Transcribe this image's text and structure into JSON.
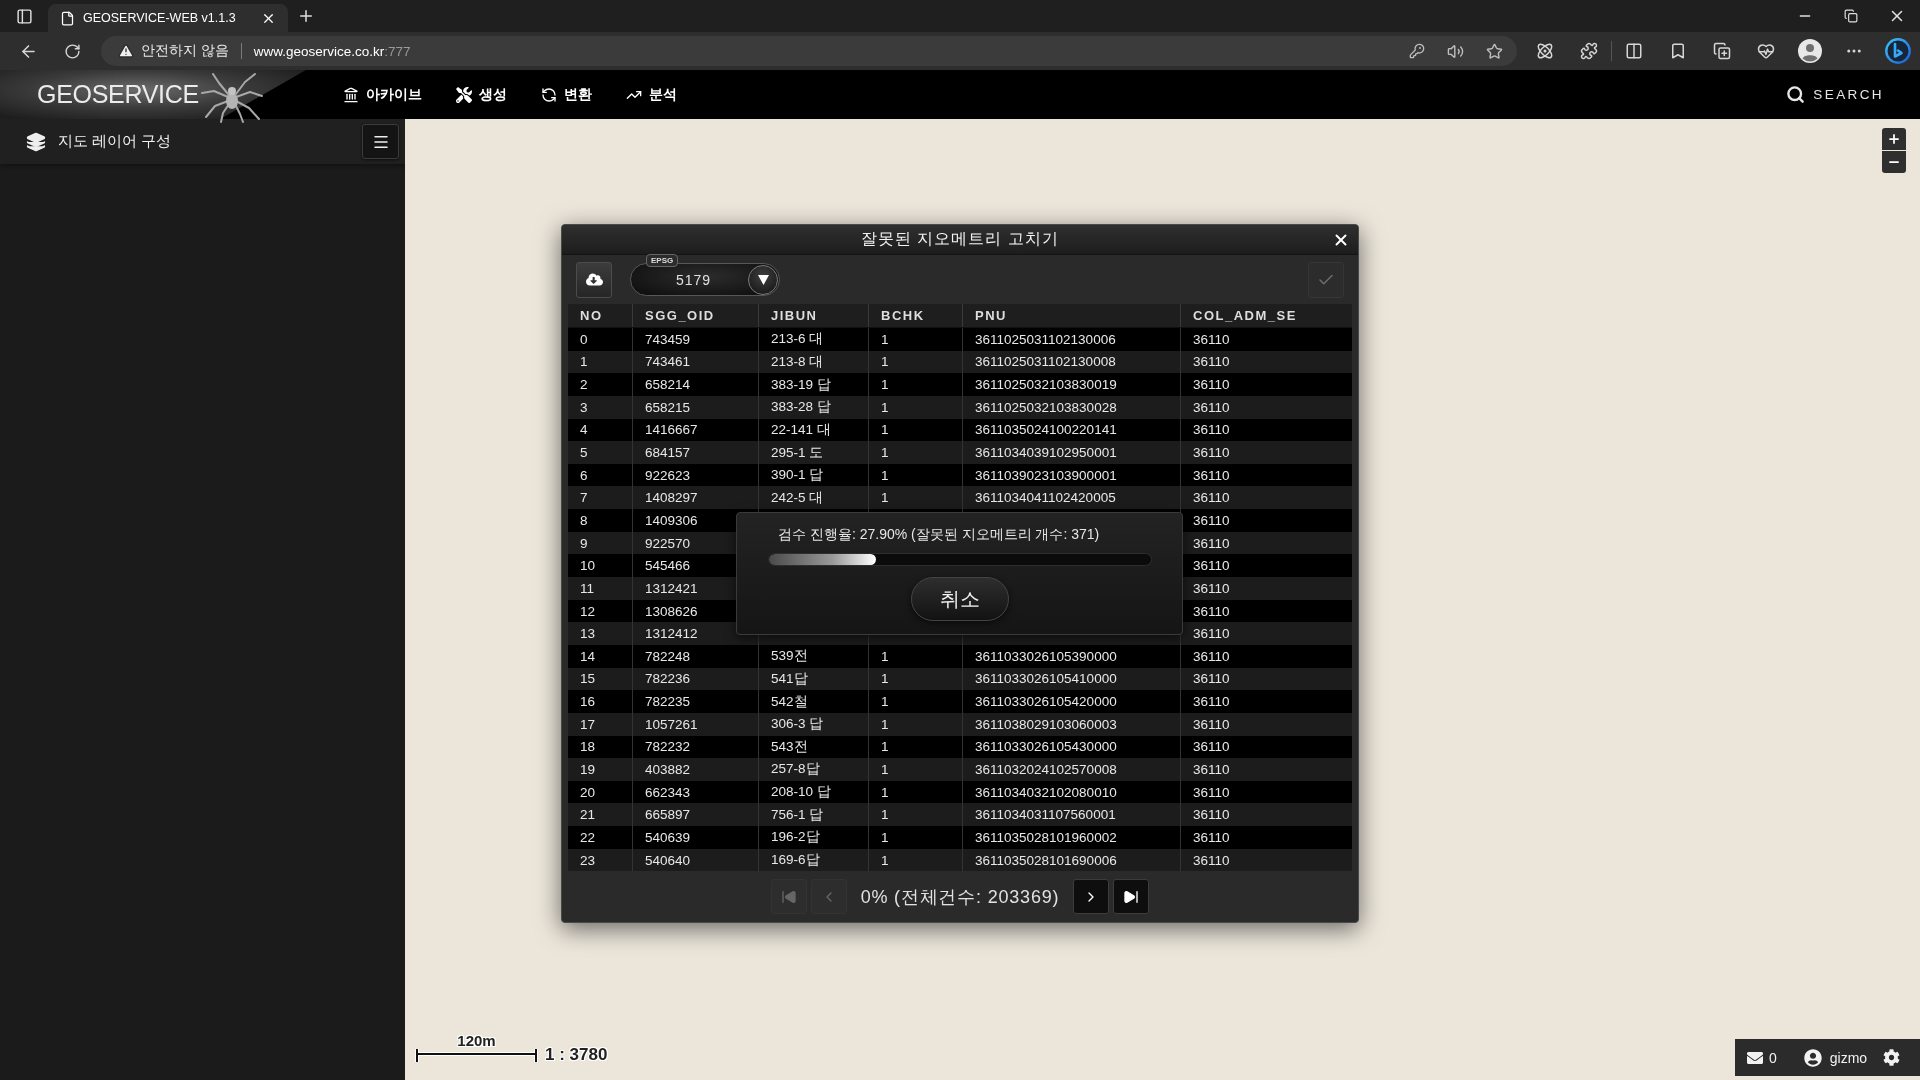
{
  "browser": {
    "tab": {
      "title": "GEOSERVICE-WEB v1.1.3"
    },
    "address_bar": {
      "security_warning": "안전하지 않음",
      "host": "www.geoservice.co.kr",
      "port": ":777"
    }
  },
  "app_header": {
    "logo": "GEOSERVICE",
    "nav": [
      {
        "label": "아카이브"
      },
      {
        "label": "생성"
      },
      {
        "label": "변환"
      },
      {
        "label": "분석"
      }
    ],
    "search": "SEARCH"
  },
  "sidebar": {
    "title": "지도 레이어 구성"
  },
  "map": {
    "scale_label": "120m",
    "scale_ratio": "1 : 3780"
  },
  "dialog": {
    "title": "잘못된 지오메트리 고치기",
    "epsg": {
      "label": "EPSG",
      "value": "5179"
    },
    "apply_button": {
      "disabled": true
    },
    "table": {
      "columns": [
        "NO",
        "SGG_OID",
        "JIBUN",
        "BCHK",
        "PNU",
        "COL_ADM_SE"
      ],
      "rows": [
        {
          "no": "0",
          "sgg_oid": "743459",
          "jibun": "213-6 대",
          "bchk": "1",
          "pnu": "3611025031102130006",
          "col_adm_se": "36110"
        },
        {
          "no": "1",
          "sgg_oid": "743461",
          "jibun": "213-8 대",
          "bchk": "1",
          "pnu": "3611025031102130008",
          "col_adm_se": "36110"
        },
        {
          "no": "2",
          "sgg_oid": "658214",
          "jibun": "383-19 답",
          "bchk": "1",
          "pnu": "3611025032103830019",
          "col_adm_se": "36110"
        },
        {
          "no": "3",
          "sgg_oid": "658215",
          "jibun": "383-28 답",
          "bchk": "1",
          "pnu": "3611025032103830028",
          "col_adm_se": "36110"
        },
        {
          "no": "4",
          "sgg_oid": "1416667",
          "jibun": "22-141 대",
          "bchk": "1",
          "pnu": "3611035024100220141",
          "col_adm_se": "36110"
        },
        {
          "no": "5",
          "sgg_oid": "684157",
          "jibun": "295-1 도",
          "bchk": "1",
          "pnu": "3611034039102950001",
          "col_adm_se": "36110"
        },
        {
          "no": "6",
          "sgg_oid": "922623",
          "jibun": "390-1 답",
          "bchk": "1",
          "pnu": "3611039023103900001",
          "col_adm_se": "36110"
        },
        {
          "no": "7",
          "sgg_oid": "1408297",
          "jibun": "242-5 대",
          "bchk": "1",
          "pnu": "3611034041102420005",
          "col_adm_se": "36110"
        },
        {
          "no": "8",
          "sgg_oid": "1409306",
          "col_adm_se": "36110"
        },
        {
          "no": "9",
          "sgg_oid": "922570",
          "col_adm_se": "36110"
        },
        {
          "no": "10",
          "sgg_oid": "545466",
          "col_adm_se": "36110"
        },
        {
          "no": "11",
          "sgg_oid": "1312421",
          "col_adm_se": "36110"
        },
        {
          "no": "12",
          "sgg_oid": "1308626",
          "col_adm_se": "36110"
        },
        {
          "no": "13",
          "sgg_oid": "1312412",
          "col_adm_se": "36110"
        },
        {
          "no": "14",
          "sgg_oid": "782248",
          "jibun": "539전",
          "bchk": "1",
          "pnu": "3611033026105390000",
          "col_adm_se": "36110"
        },
        {
          "no": "15",
          "sgg_oid": "782236",
          "jibun": "541답",
          "bchk": "1",
          "pnu": "3611033026105410000",
          "col_adm_se": "36110"
        },
        {
          "no": "16",
          "sgg_oid": "782235",
          "jibun": "542철",
          "bchk": "1",
          "pnu": "3611033026105420000",
          "col_adm_se": "36110"
        },
        {
          "no": "17",
          "sgg_oid": "1057261",
          "jibun": "306-3 답",
          "bchk": "1",
          "pnu": "3611038029103060003",
          "col_adm_se": "36110"
        },
        {
          "no": "18",
          "sgg_oid": "782232",
          "jibun": "543전",
          "bchk": "1",
          "pnu": "3611033026105430000",
          "col_adm_se": "36110"
        },
        {
          "no": "19",
          "sgg_oid": "403882",
          "jibun": "257-8답",
          "bchk": "1",
          "pnu": "3611032024102570008",
          "col_adm_se": "36110"
        },
        {
          "no": "20",
          "sgg_oid": "662343",
          "jibun": "208-10 답",
          "bchk": "1",
          "pnu": "3611034032102080010",
          "col_adm_se": "36110"
        },
        {
          "no": "21",
          "sgg_oid": "665897",
          "jibun": "756-1 답",
          "bchk": "1",
          "pnu": "3611034031107560001",
          "col_adm_se": "36110"
        },
        {
          "no": "22",
          "sgg_oid": "540639",
          "jibun": "196-2답",
          "bchk": "1",
          "pnu": "3611035028101960002",
          "col_adm_se": "36110"
        },
        {
          "no": "23",
          "sgg_oid": "540640",
          "jibun": "169-6답",
          "bchk": "1",
          "pnu": "3611035028101690006",
          "col_adm_se": "36110"
        }
      ]
    },
    "progress": {
      "text": "검수 진행율: 27.90% (잘못된 지오메트리 개수: 371)",
      "level": 0.279,
      "cancel": "취소"
    },
    "pagination": {
      "buttons": [
        {
          "kind": "first",
          "disabled": true
        },
        {
          "kind": "prev",
          "disabled": true
        },
        {
          "kind": "next",
          "disabled": false
        },
        {
          "kind": "last",
          "disabled": false
        }
      ],
      "summary": "0% (전체건수: 203369)"
    }
  },
  "status_bar": {
    "mail_count": "0",
    "user": "gizmo"
  }
}
